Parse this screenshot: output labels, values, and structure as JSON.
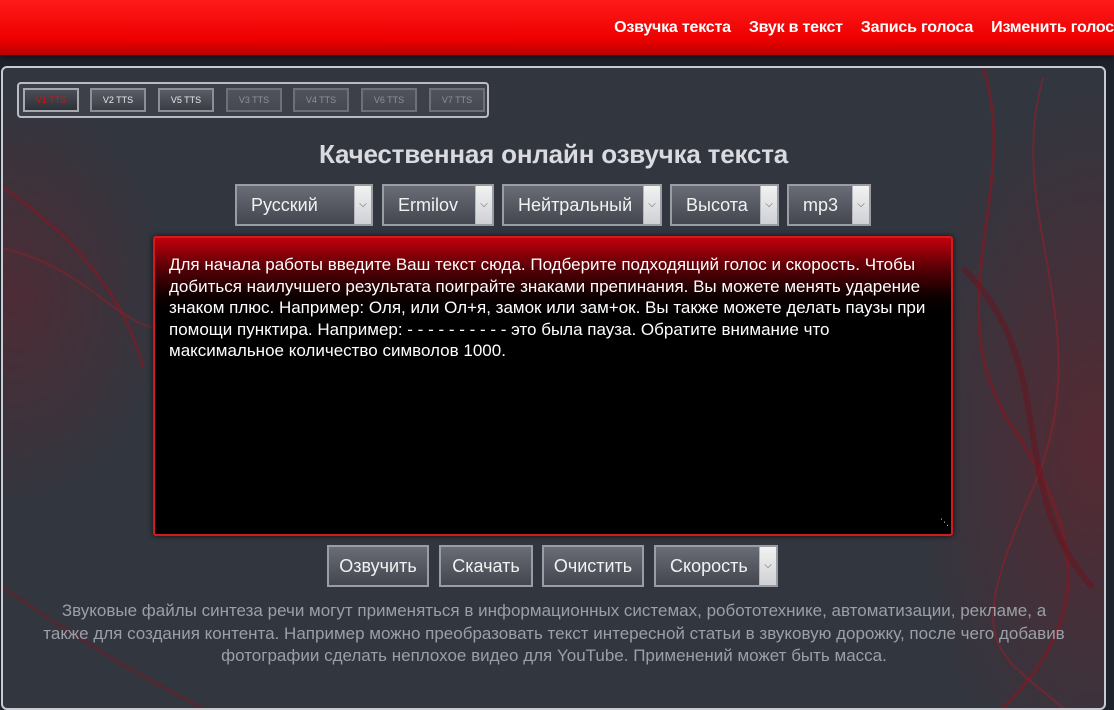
{
  "topnav": {
    "items": [
      "Озвучка текста",
      "Звук в текст",
      "Запись голоса",
      "Изменить голос"
    ]
  },
  "version_tabs": [
    {
      "label": "V1 TTS",
      "state": "active"
    },
    {
      "label": "V2 TTS",
      "state": "enabled"
    },
    {
      "label": "V5 TTS",
      "state": "enabled"
    },
    {
      "label": "V3 TTS",
      "state": "disabled"
    },
    {
      "label": "V4 TTS",
      "state": "disabled"
    },
    {
      "label": "V6 TTS",
      "state": "disabled"
    },
    {
      "label": "V7 TTS",
      "state": "disabled"
    }
  ],
  "title": "Качественная онлайн озвучка текста",
  "selects": {
    "language": "Русский",
    "voice": "Ermilov",
    "emotion": "Нейтральный",
    "pitch": "Высота",
    "format": "mp3"
  },
  "editor": {
    "text": "Для начала работы введите Ваш текст сюда. Подберите подходящий голос и скорость. Чтобы добиться наилучшего результата поиграйте знаками препинания. Вы можете менять ударение знаком плюс. Например: Оля, или Ол+я, замок или зам+ок. Вы также можете делать паузы при помощи пунктира. Например: - - - - - - - - - - это была пауза. Обратите внимание что максимальное количество символов 1000."
  },
  "actions": {
    "speak": "Озвучить",
    "download": "Скачать",
    "clear": "Очистить",
    "speed": "Скорость"
  },
  "description": "Звуковые файлы синтеза речи могут применяться в информационных системах, робототехнике, автоматизации, рекламе, а также для создания контента. Например можно преобразовать текст интересной статьи в звуковую дорожку, после чего добавив фотографии сделать неплохое видео для YouTube. Применений может быть масса.",
  "colors": {
    "accent_red": "#e60000",
    "panel_bg": "#32363f",
    "editor_border": "#d41b1b"
  }
}
